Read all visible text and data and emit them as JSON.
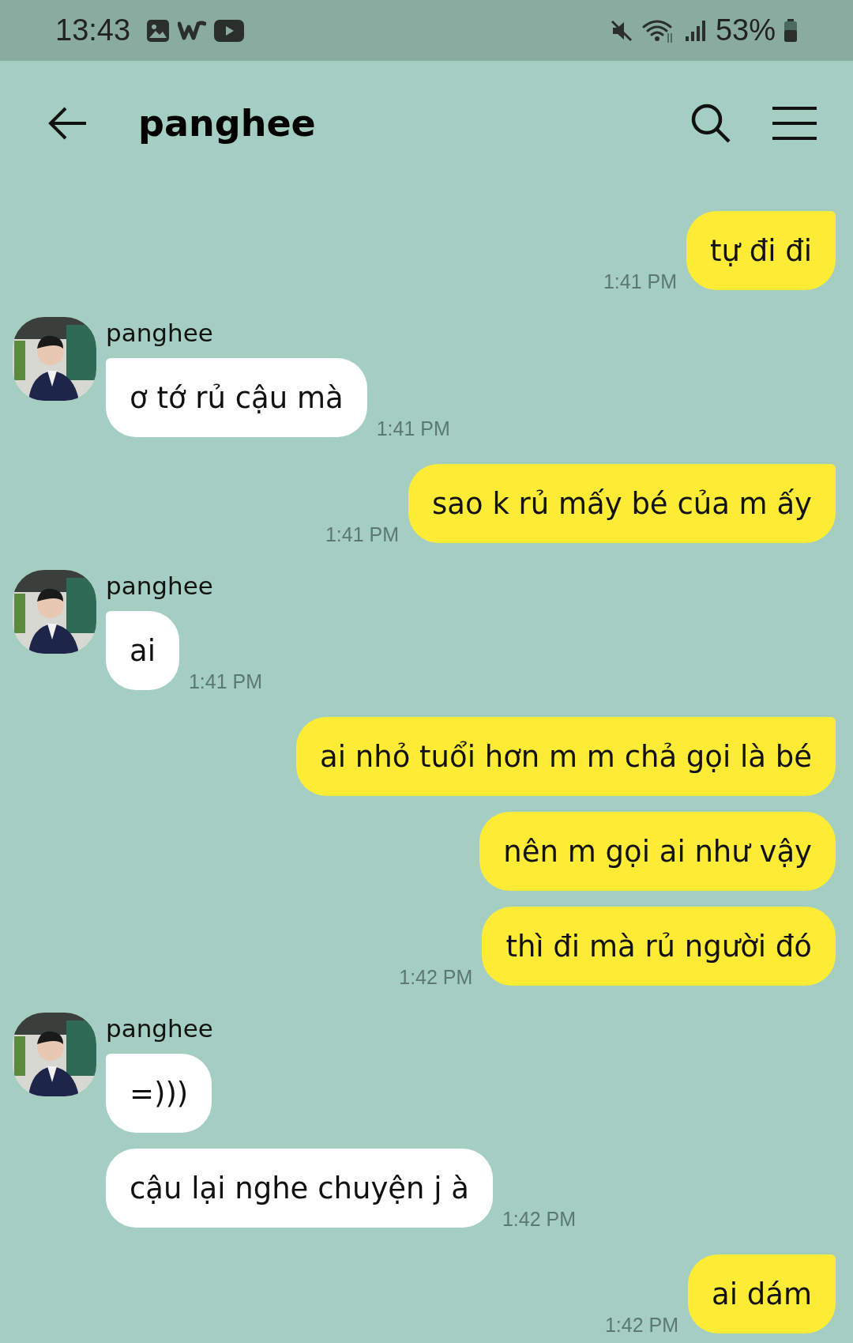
{
  "status_bar": {
    "time": "13:43",
    "battery": "53%"
  },
  "header": {
    "title": "panghee"
  },
  "groups": [
    {
      "kind": "outgoing",
      "messages": [
        {
          "text": "tự đi đi",
          "time": "1:41 PM"
        }
      ]
    },
    {
      "kind": "incoming",
      "sender": "panghee",
      "messages": [
        {
          "text": "ơ tớ rủ cậu mà",
          "time": "1:41 PM"
        }
      ]
    },
    {
      "kind": "outgoing",
      "messages": [
        {
          "text": "sao k rủ mấy bé của m ấy",
          "time": "1:41 PM"
        }
      ]
    },
    {
      "kind": "incoming",
      "sender": "panghee",
      "messages": [
        {
          "text": "ai",
          "time": "1:41 PM"
        }
      ]
    },
    {
      "kind": "outgoing",
      "messages": [
        {
          "text": "ai nhỏ tuổi hơn m m chả gọi là bé"
        },
        {
          "text": "nên m gọi ai như vậy"
        },
        {
          "text": "thì đi mà rủ người đó",
          "time": "1:42 PM"
        }
      ]
    },
    {
      "kind": "incoming",
      "sender": "panghee",
      "messages": [
        {
          "text": "=)))"
        },
        {
          "text": "cậu lại nghe chuyện j à",
          "time": "1:42 PM"
        }
      ]
    },
    {
      "kind": "outgoing",
      "messages": [
        {
          "text": "ai dám",
          "time": "1:42 PM"
        }
      ]
    }
  ]
}
